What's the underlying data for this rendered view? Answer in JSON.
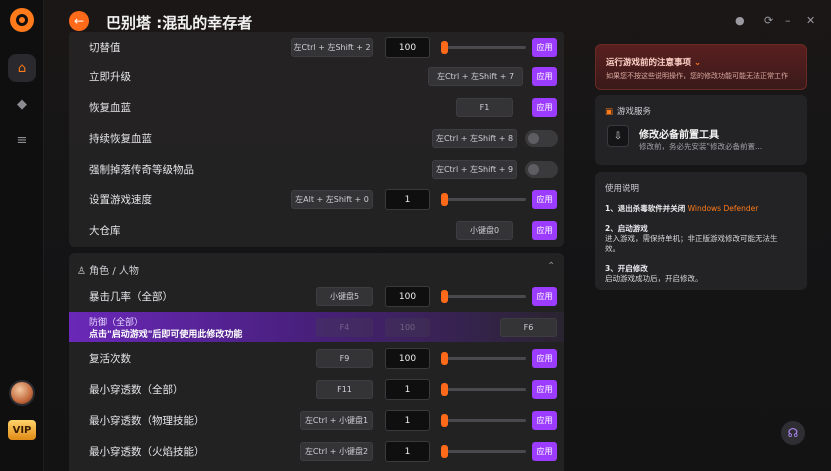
{
  "app": {
    "title": "巴别塔 :混乱的幸存者"
  },
  "rail": {
    "vip_label": "VIP"
  },
  "rows_top": [
    {
      "label": "切替值",
      "key": "左Ctrl + 左Shift + 2",
      "value": "100",
      "control": "slider+apply",
      "slider_fraction": 0.0
    },
    {
      "label": "立即升级",
      "key": "左Ctrl + 左Shift + 7",
      "control": "apply"
    },
    {
      "label": "恢复血蓝",
      "key": "F1",
      "control": "apply"
    },
    {
      "label": "持续恢复血蓝",
      "key": "左Ctrl + 左Shift + 8",
      "control": "toggle"
    },
    {
      "label": "强制掉落传奇等级物品",
      "key": "左Ctrl + 左Shift + 9",
      "control": "toggle"
    },
    {
      "label": "设置游戏速度",
      "key": "左Alt + 左Shift + 0",
      "value": "1",
      "control": "slider+apply",
      "slider_fraction": 0.0
    },
    {
      "label": "大仓库",
      "key": "小键盘0",
      "control": "apply"
    }
  ],
  "apply_label": "应用",
  "section": {
    "label": "角色 / 人物"
  },
  "rows_role": [
    {
      "label": "暴击几率（全部）",
      "key": "小键盘5",
      "value": "100",
      "slider_fraction": 0.0
    }
  ],
  "locked_row": {
    "label": "防御（全部）",
    "notice": "点击\"启动游戏\"后即可使用此修改功能",
    "key": "F6",
    "ghost_key": "F4",
    "ghost_value": "100"
  },
  "rows_role2": [
    {
      "label": "复活次数",
      "key": "F9",
      "value": "100",
      "slider_fraction": 0.0
    },
    {
      "label": "最小穿透数（全部）",
      "key": "F11",
      "value": "1",
      "slider_fraction": 0.0
    },
    {
      "label": "最小穿透数（物理技能）",
      "key": "左Ctrl + 小键盘1",
      "value": "1",
      "slider_fraction": 0.0
    },
    {
      "label": "最小穿透数（火焰技能）",
      "key": "左Ctrl + 小键盘2",
      "value": "1",
      "slider_fraction": 0.0
    }
  ],
  "notice": {
    "title": "运行游戏前的注意事项",
    "text": "如果您不按这些说明操作，您的修改功能可能无法正常工作"
  },
  "service": {
    "title": "游戏服务",
    "tool_title": "修改必备前置工具",
    "tool_desc": "修改前，务必先安装\"修改必备前置..."
  },
  "guide": {
    "title": "使用说明",
    "step1": "1、退出杀毒软件并关闭",
    "step1_highlight": "Windows Defender",
    "step2_title": "2、启动游戏",
    "step2_l1": "进入游戏，需保持单机；非正版游戏修改可能无法生",
    "step2_l2": "效。",
    "step3_title": "3、开启修改",
    "step3_l1": "启动游戏成功后，开启修改。"
  }
}
